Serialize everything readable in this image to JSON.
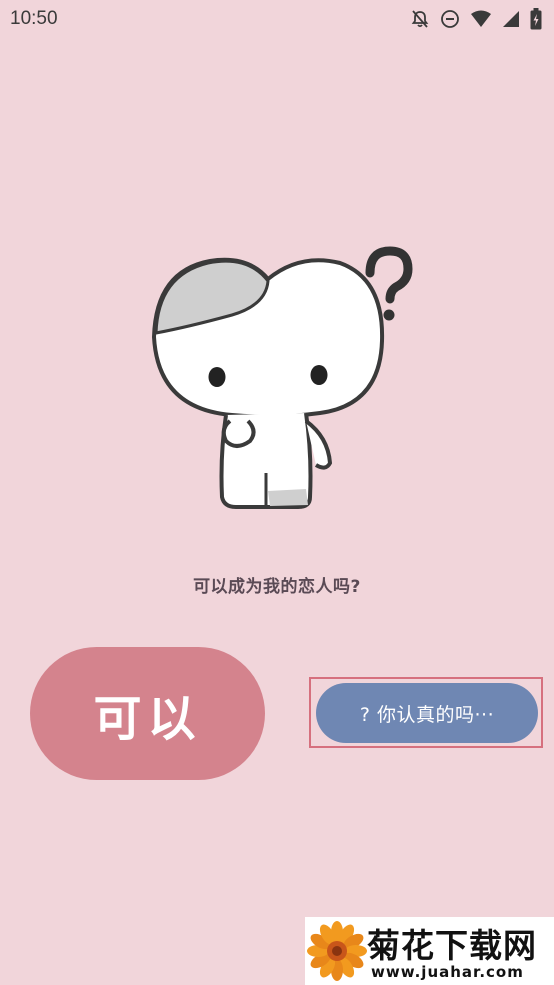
{
  "status_bar": {
    "time": "10:50",
    "icons": [
      "notifications-off-icon",
      "do-not-disturb-icon",
      "wifi-icon",
      "signal-icon",
      "battery-charging-icon"
    ]
  },
  "illustration": {
    "icon": "confused-character-icon"
  },
  "prompt": {
    "text": "可以成为我的恋人吗?"
  },
  "buttons": {
    "yes_label": "可以",
    "question_label": "? 你认真的吗···"
  },
  "watermark": {
    "title": "菊花下载网",
    "url": "www.juahar.com"
  },
  "colors": {
    "background": "#f1d5da",
    "yes_button": "#d4838d",
    "question_button": "#6f87b3",
    "highlight": "#d6707e"
  }
}
